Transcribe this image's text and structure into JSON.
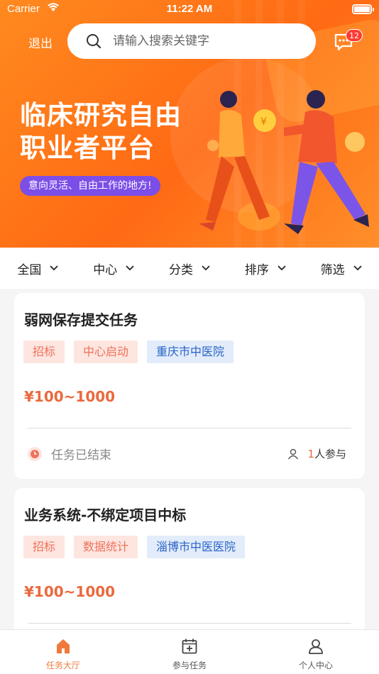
{
  "status_bar": {
    "carrier": "Carrier",
    "time": "11:22 AM"
  },
  "header": {
    "logout_label": "退出",
    "search_placeholder": "请输入搜索关键字",
    "message_badge": "12"
  },
  "banner": {
    "title_line1": "临床研究自由",
    "title_line2": "职业者平台",
    "subtitle": "意向灵活、自由工作的地方!"
  },
  "filters": [
    "全国",
    "中心",
    "分类",
    "排序",
    "筛选"
  ],
  "tasks": [
    {
      "title": "弱网保存提交任务",
      "tags": [
        "招标",
        "中心启动",
        "重庆市中医院"
      ],
      "price": "¥100~1000",
      "status": "任务已结束",
      "participants_count": "1",
      "participants_suffix": "人参与"
    },
    {
      "title": "业务系统-不绑定项目中标",
      "tags": [
        "招标",
        "数据统计",
        "淄博市中医医院"
      ],
      "price": "¥100~1000"
    }
  ],
  "tabbar": {
    "tabs": [
      "任务大厅",
      "参与任务",
      "个人中心"
    ],
    "active_index": 0,
    "accent_color": "#f07a3e"
  },
  "colors": {
    "banner_orange": "#ff6a14",
    "price": "#ea6a3d",
    "tag_red_text": "#f0725a",
    "tag_blue_text": "#2a63c8"
  }
}
